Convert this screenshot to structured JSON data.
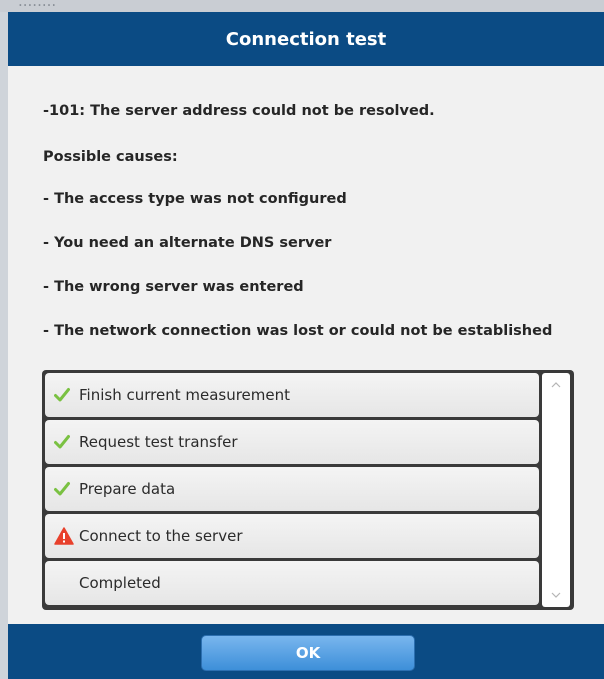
{
  "backdrop": {
    "partial_text": "........"
  },
  "dialog": {
    "title": "Connection test",
    "error_message": "-101: The server address could not be resolved.",
    "causes_heading": "Possible causes:",
    "causes": [
      "- The access type was not configured",
      "- You need an alternate DNS server",
      "- The wrong server was entered",
      "- The network connection was lost or could not be established"
    ],
    "steps": [
      {
        "label": "Finish current measurement",
        "status": "done",
        "icon": "check-icon"
      },
      {
        "label": "Request test transfer",
        "status": "done",
        "icon": "check-icon"
      },
      {
        "label": "Prepare data",
        "status": "done",
        "icon": "check-icon"
      },
      {
        "label": "Connect to the server",
        "status": "error",
        "icon": "warning-icon"
      },
      {
        "label": "Completed",
        "status": "pending",
        "icon": ""
      }
    ],
    "ok_label": "OK"
  },
  "colors": {
    "header": "#0b4b84",
    "check": "#7ac142",
    "warning": "#e8412c",
    "button": "#4a9ae0"
  }
}
